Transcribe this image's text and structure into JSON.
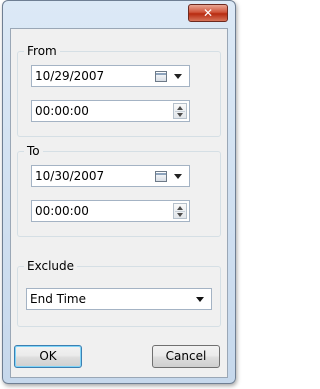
{
  "dialog": {
    "close_glyph": "✕",
    "from": {
      "legend": "From",
      "date": "10/29/2007",
      "time": "00:00:00"
    },
    "to": {
      "legend": "To",
      "date": "10/30/2007",
      "time": "00:00:00"
    },
    "exclude": {
      "legend": "Exclude",
      "selected": "End Time"
    },
    "ok_label": "OK",
    "cancel_label": "Cancel"
  },
  "icons": {
    "close": "close-icon",
    "calendar": "calendar-icon",
    "dropdown": "chevron-down-icon",
    "spinner": "spinner-arrows-icon"
  },
  "colors": {
    "title_gradient_top": "#dce9f6",
    "client_bg": "#f0f0f0",
    "close_button": "#c7432a",
    "default_button_border": "#3c7fb1"
  }
}
